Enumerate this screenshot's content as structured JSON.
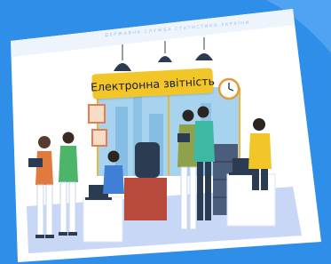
{
  "banner": {
    "title": "Електронна звітність",
    "subtitle": "ДЕРЖАВНА СЛУЖБА СТАТИСТИКИ УКРАЇНИ"
  },
  "colors": {
    "background_blue": "#2f8ee8",
    "card": "#ffffff",
    "banner_yellow": "#f2c629",
    "window_glass": "#a7d3ef",
    "floor": "#c8d7f5"
  },
  "icons": [
    "pendant-lamp-icon",
    "wall-clock-icon",
    "laptop-icon",
    "office-chair-icon",
    "file-cabinet-icon",
    "picture-frame-icon"
  ]
}
